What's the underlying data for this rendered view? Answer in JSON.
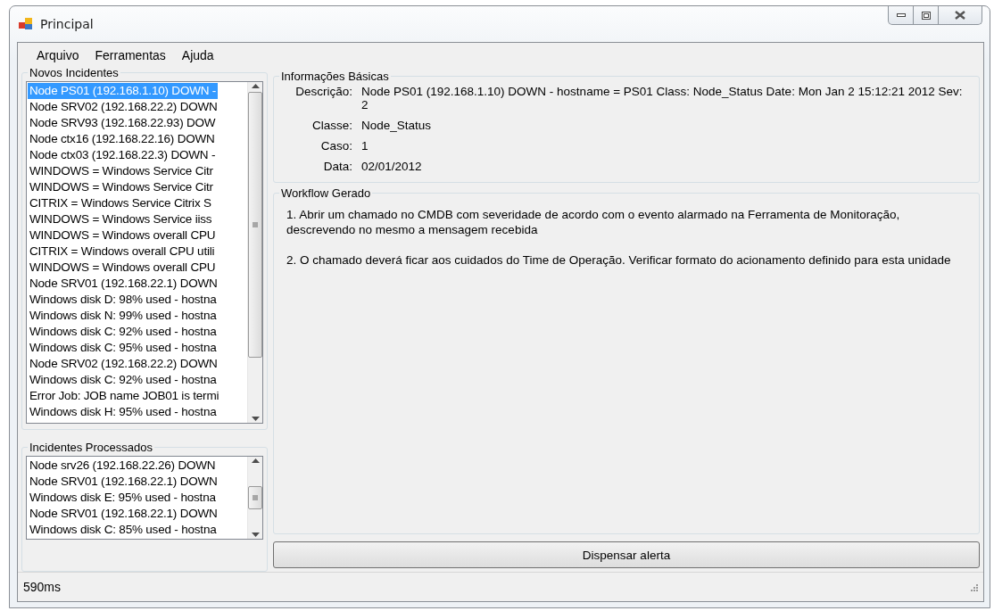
{
  "window": {
    "title": "Principal"
  },
  "menu": [
    "Arquivo",
    "Ferramentas",
    "Ajuda"
  ],
  "new_incidents": {
    "title": "Novos Incidentes",
    "items": [
      {
        "text": "Node PS01 (192.168.1.10) DOWN -",
        "selected": true
      },
      {
        "text": "Node SRV02 (192.168.22.2) DOWN",
        "selected": false
      },
      {
        "text": "Node SRV93 (192.168.22.93) DOW",
        "selected": false
      },
      {
        "text": "Node ctx16 (192.168.22.16) DOWN",
        "selected": false
      },
      {
        "text": "Node ctx03 (192.168.22.3) DOWN -",
        "selected": false
      },
      {
        "text": "WINDOWS = Windows Service Citr",
        "selected": false
      },
      {
        "text": "WINDOWS = Windows Service Citr",
        "selected": false
      },
      {
        "text": "CITRIX = Windows Service Citrix S",
        "selected": false
      },
      {
        "text": "WINDOWS = Windows Service iiss",
        "selected": false
      },
      {
        "text": "WINDOWS = Windows overall CPU",
        "selected": false
      },
      {
        "text": "CITRIX = Windows overall CPU utili",
        "selected": false
      },
      {
        "text": "WINDOWS = Windows overall CPU",
        "selected": false
      },
      {
        "text": "Node SRV01 (192.168.22.1) DOWN",
        "selected": false
      },
      {
        "text": "Windows disk D: 98% used - hostna",
        "selected": false
      },
      {
        "text": "Windows disk N: 99% used - hostna",
        "selected": false
      },
      {
        "text": "Windows disk C: 92% used - hostna",
        "selected": false
      },
      {
        "text": "Windows disk C: 95% used - hostna",
        "selected": false
      },
      {
        "text": "Node SRV02 (192.168.22.2) DOWN",
        "selected": false
      },
      {
        "text": "Windows disk C: 92% used - hostna",
        "selected": false
      },
      {
        "text": "Error Job: JOB name JOB01 is termi",
        "selected": false
      },
      {
        "text": "Windows disk H: 95% used - hostna",
        "selected": false
      }
    ]
  },
  "processed_incidents": {
    "title": "Incidentes Processados",
    "items": [
      {
        "text": "Node srv26 (192.168.22.26) DOWN",
        "selected": false
      },
      {
        "text": "Node SRV01 (192.168.22.1) DOWN",
        "selected": false
      },
      {
        "text": "Windows disk E: 95% used - hostna",
        "selected": false
      },
      {
        "text": "Node SRV01 (192.168.22.1) DOWN",
        "selected": false
      },
      {
        "text": "Windows disk C: 85% used - hostna",
        "selected": false
      }
    ]
  },
  "basic_info": {
    "title": "Informações Básicas",
    "fields": [
      {
        "label": "Descrição:",
        "value": "Node PS01 (192.168.1.10) DOWN - hostname = PS01 Class: Node_Status Date: Mon Jan 2 15:12:21 2012 Sev: 2"
      },
      {
        "label": "Classe:",
        "value": "Node_Status"
      },
      {
        "label": "Caso:",
        "value": "1"
      },
      {
        "label": "Data:",
        "value": "02/01/2012"
      }
    ]
  },
  "workflow": {
    "title": "Workflow Gerado",
    "steps": [
      "1. Abrir um chamado no CMDB com severidade de acordo com o evento alarmado na Ferramenta de Monitoração, descrevendo no mesmo a mensagem recebida",
      "2. O chamado deverá ficar aos cuidados do Time de Operação. Verificar formato do acionamento definido para esta unidade"
    ]
  },
  "dismiss_button": "Dispensar alerta",
  "status_bar": {
    "text": "590ms"
  }
}
